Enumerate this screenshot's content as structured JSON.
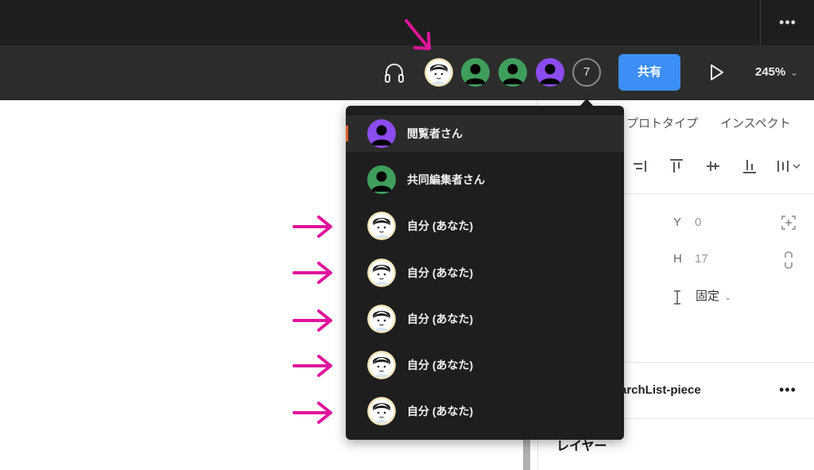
{
  "toolbar": {
    "more_label": "•••",
    "collaborator_count": "7",
    "share_label": "共有",
    "zoom_label": "245%",
    "zoom_chevron": "⌄"
  },
  "panel": {
    "tabs": [
      "プロトタイプ",
      "インスペクト"
    ],
    "y_label": "Y",
    "y_value": "0",
    "h_label": "H",
    "h_value": "17",
    "fixed_label": "固定",
    "layer_name": "archList-piece",
    "layer_more": "•••",
    "layers_title": "レイヤー"
  },
  "dropdown": {
    "items": [
      {
        "label": "閲覧者さん",
        "avatar": "purple-user-icon",
        "active": true
      },
      {
        "label": "共同編集者さん",
        "avatar": "green-user-icon",
        "active": false
      },
      {
        "label": "自分 (あなた)",
        "avatar": "self-avatar-icon",
        "active": false
      },
      {
        "label": "自分 (あなた)",
        "avatar": "self-avatar-icon",
        "active": false
      },
      {
        "label": "自分 (あなた)",
        "avatar": "self-avatar-icon",
        "active": false
      },
      {
        "label": "自分 (あなた)",
        "avatar": "self-avatar-icon",
        "active": false
      },
      {
        "label": "自分 (あなた)",
        "avatar": "self-avatar-icon",
        "active": false
      }
    ]
  },
  "colors": {
    "accent": "#3d8ff5",
    "annotation_arrow": "#e0139c",
    "viewer_avatar": "#8b4cf0",
    "editor_avatar": "#3f9e5c",
    "active_marker": "#e0622b"
  }
}
